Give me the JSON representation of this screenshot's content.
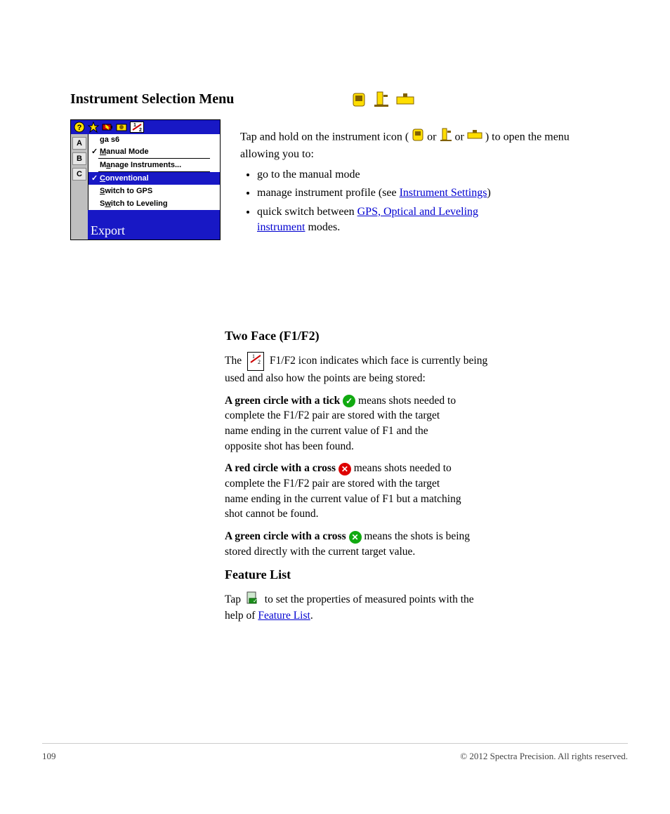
{
  "title": "Instrument Selection Menu",
  "inst_icons": [
    "gps-icon",
    "totalstation-icon",
    "level-icon"
  ],
  "screenshot_menu": {
    "title": "ga s6",
    "left_keys": [
      "A",
      "B",
      "C"
    ],
    "bottom_text": "Export",
    "items": [
      {
        "type": "item",
        "label": "Manual Mode",
        "check": true,
        "hotkey_index": 0
      },
      {
        "type": "sep"
      },
      {
        "type": "item",
        "label": "Manage Instruments...",
        "check": false,
        "hotkey_index": 1
      },
      {
        "type": "sep"
      },
      {
        "type": "item",
        "label": "Conventional",
        "check": true,
        "hotkey_index": 0,
        "selected": true
      },
      {
        "type": "item",
        "label": "Switch to GPS",
        "check": false,
        "hotkey_index": 0
      },
      {
        "type": "item",
        "label": "Switch to Leveling",
        "check": false,
        "hotkey_index": 1
      }
    ]
  },
  "intro": {
    "l1": "Tap and hold on the instrument icon (",
    "l2": " or ",
    "l3": " or ",
    "l4": ") to open the menu allowing you to:",
    "bullets": [
      "go to the manual mode",
      "manage instrument profile (see",
      "quick switch between",
      "modes."
    ],
    "link1": "Instrument Settings",
    "rp": ")",
    "mid_text": "GPS, Optical and Leveling",
    "link2": "instrument"
  },
  "twoface": {
    "heading": "Two Face (F1/F2)",
    "l1a": "The ",
    "l1b": " F1/F2 icon indicates which face is currently being",
    "l1c": "used and also how the points are being stored:",
    "s1a": "A green circle with a tick ",
    "s1b": " means shots needed to",
    "s1c": "complete the F1/F2 pair are stored with the target",
    "s1d": "name ending in the current value of F1 and the",
    "s1e": "opposite shot has been found.",
    "s2a": "A red circle with a cross ",
    "s2b": " means shots needed to",
    "s2c": "complete the F1/F2 pair are stored with the target",
    "s2d": "name ending in the current value of F1 but a matching",
    "s2e": "shot cannot be found.",
    "s3a": "A green circle with a cross ",
    "s3b": " means the shots is being",
    "s3c": "stored directly with the current target value."
  },
  "feature": {
    "heading": "Feature List",
    "l1a": "Tap ",
    "l1b": " to set the properties of measured points with the",
    "l1c": "help of ",
    "link": "Feature List",
    "rp": "."
  },
  "footer": {
    "page": "109",
    "copyright": "© 2012 Spectra Precision. All rights reserved."
  }
}
